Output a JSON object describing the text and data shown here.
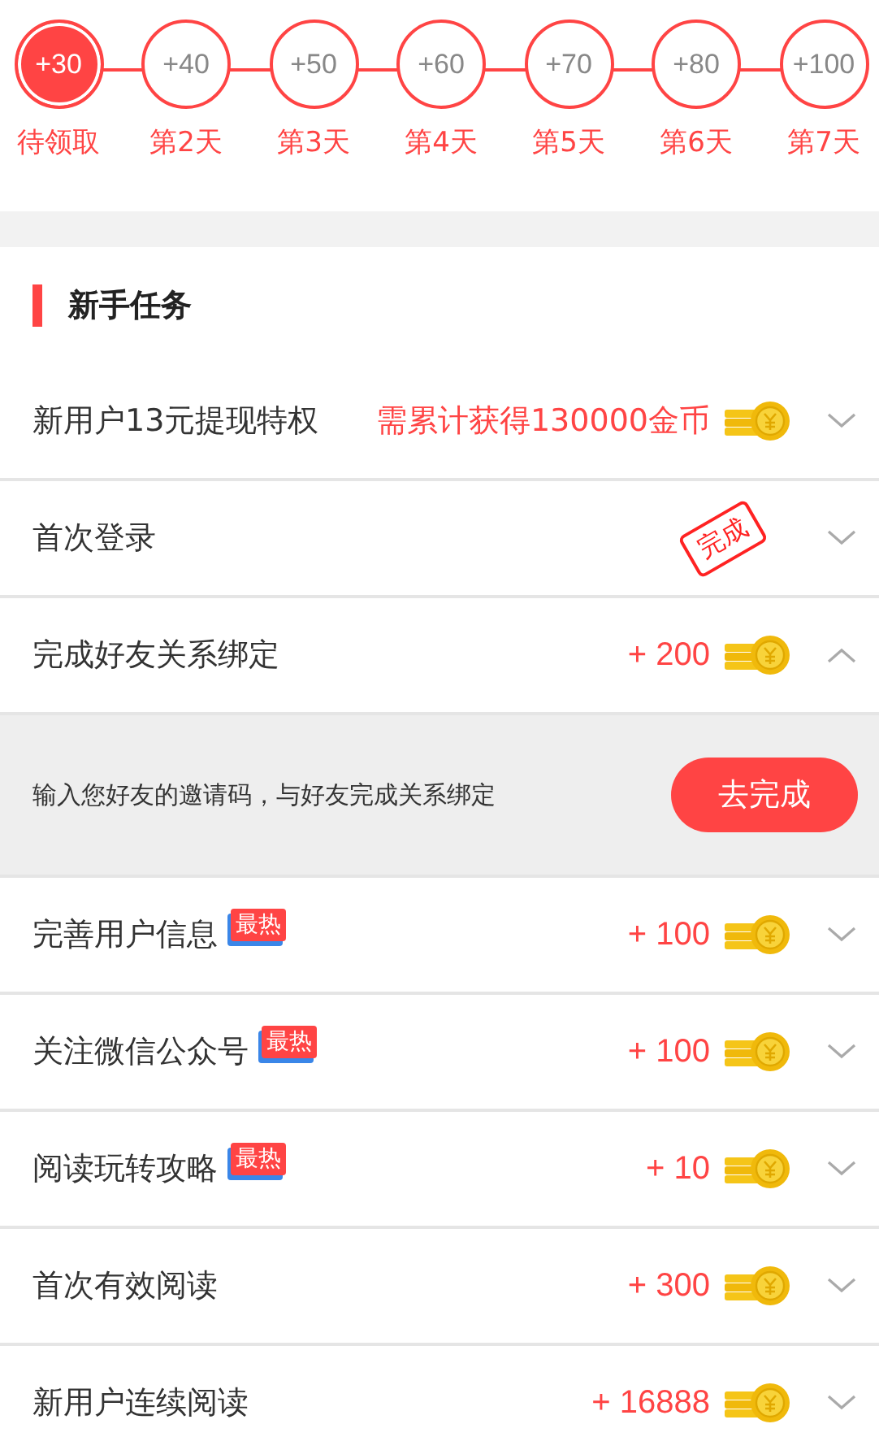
{
  "checkin": [
    {
      "amount": "+30",
      "label": "待领取",
      "selected": true
    },
    {
      "amount": "+40",
      "label": "第2天",
      "selected": false
    },
    {
      "amount": "+50",
      "label": "第3天",
      "selected": false
    },
    {
      "amount": "+60",
      "label": "第4天",
      "selected": false
    },
    {
      "amount": "+70",
      "label": "第5天",
      "selected": false
    },
    {
      "amount": "+80",
      "label": "第6天",
      "selected": false
    },
    {
      "amount": "+100",
      "label": "第7天",
      "selected": false
    }
  ],
  "section": {
    "title": "新手任务"
  },
  "tasks": [
    {
      "kind": "coins",
      "title": "新用户13元提现特权",
      "reward": "需累计获得130000金币",
      "expanded": false
    },
    {
      "kind": "done",
      "title": "首次登录",
      "stamp": "完成",
      "expanded": false
    },
    {
      "kind": "coins",
      "title": "完成好友关系绑定",
      "reward": "+ 200",
      "expanded": true,
      "detail": "输入您好友的邀请码，与好友完成关系绑定",
      "action": "去完成"
    },
    {
      "kind": "coins",
      "title": "完善用户信息",
      "badge": "最热",
      "reward": "+ 100",
      "expanded": false
    },
    {
      "kind": "coins",
      "title": "关注微信公众号",
      "badge": "最热",
      "reward": "+ 100",
      "expanded": false
    },
    {
      "kind": "coins",
      "title": "阅读玩转攻略",
      "badge": "最热",
      "reward": "+ 10",
      "expanded": false
    },
    {
      "kind": "coins",
      "title": "首次有效阅读",
      "reward": "+ 300",
      "expanded": false
    },
    {
      "kind": "coins",
      "title": "新用户连续阅读",
      "reward": "+ 16888",
      "expanded": false
    }
  ]
}
